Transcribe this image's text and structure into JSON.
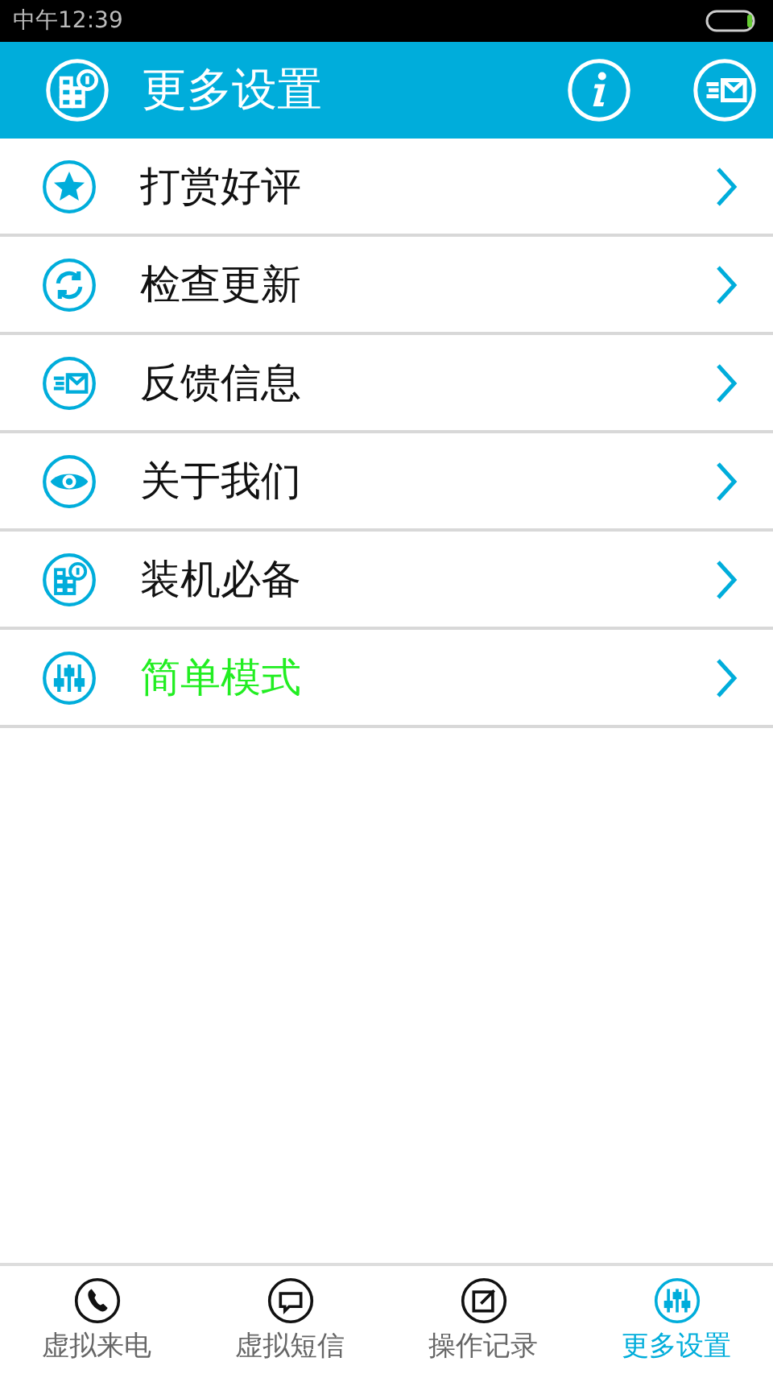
{
  "status_bar": {
    "time": "中午12:39"
  },
  "header": {
    "title": "更多设置"
  },
  "menu": [
    {
      "kind": "star",
      "label": "打赏好评",
      "highlighted": false
    },
    {
      "kind": "refresh",
      "label": "检查更新",
      "highlighted": false
    },
    {
      "kind": "mail",
      "label": "反馈信息",
      "highlighted": false
    },
    {
      "kind": "eye",
      "label": "关于我们",
      "highlighted": false
    },
    {
      "kind": "apps",
      "label": "装机必备",
      "highlighted": false
    },
    {
      "kind": "sliders",
      "label": "简单模式",
      "highlighted": true
    }
  ],
  "tabs": [
    {
      "kind": "phone",
      "label": "虚拟来电",
      "selected": false
    },
    {
      "kind": "chat",
      "label": "虚拟短信",
      "selected": false
    },
    {
      "kind": "edit",
      "label": "操作记录",
      "selected": false
    },
    {
      "kind": "sliders",
      "label": "更多设置",
      "selected": true
    }
  ]
}
